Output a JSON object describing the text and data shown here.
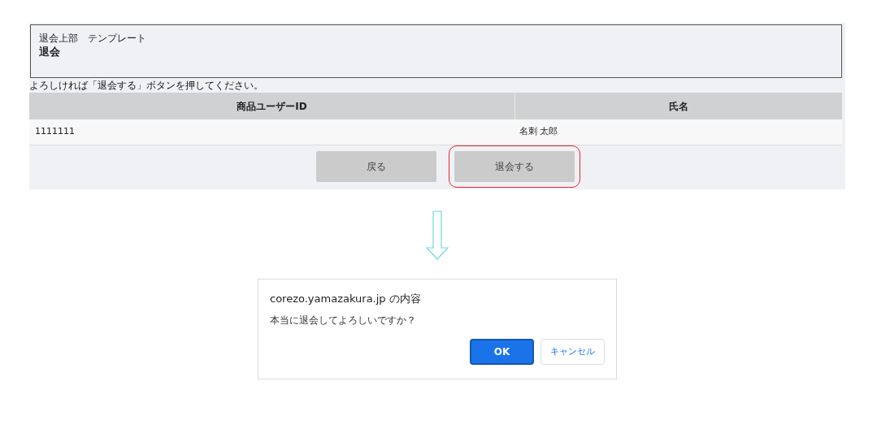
{
  "header": {
    "subtitle": "退会上部　テンプレート",
    "title": "退会"
  },
  "instruction": "よろしければ「退会する」ボタンを押してください。",
  "table": {
    "columns": [
      "商品ユーザーID",
      "氏名"
    ],
    "rows": [
      [
        "1111111",
        "名刺 太郎"
      ]
    ]
  },
  "buttons": [
    {
      "label": "戻る",
      "highlighted": false
    },
    {
      "label": "退会する",
      "highlighted": true
    }
  ],
  "dialog": {
    "title": "corezo.yamazakura.jp の内容",
    "message": "本当に退会してよろしいですか？",
    "buttons": [
      {
        "label": "OK",
        "kind": "primary"
      },
      {
        "label": "キャンセル",
        "kind": "secondary"
      }
    ]
  }
}
